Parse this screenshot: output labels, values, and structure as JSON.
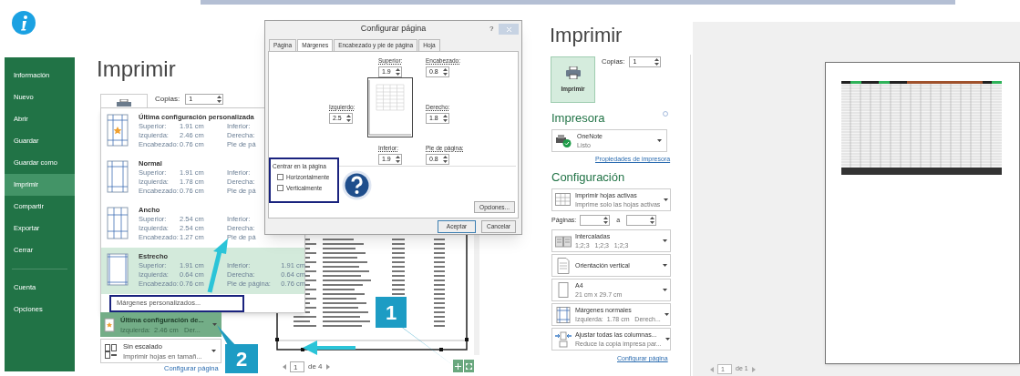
{
  "left_window": {
    "sidebar": {
      "items": [
        {
          "label": "Información",
          "selected": false
        },
        {
          "label": "Nuevo",
          "selected": false
        },
        {
          "label": "Abrir",
          "selected": false
        },
        {
          "label": "Guardar",
          "selected": false
        },
        {
          "label": "Guardar como",
          "selected": false
        },
        {
          "label": "Imprimir",
          "selected": true
        },
        {
          "label": "Compartir",
          "selected": false
        },
        {
          "label": "Exportar",
          "selected": false
        },
        {
          "label": "Cerrar",
          "selected": false
        }
      ],
      "footer_items": [
        {
          "label": "Cuenta",
          "selected": false
        },
        {
          "label": "Opciones",
          "selected": false
        }
      ]
    },
    "title": "Imprimir",
    "copies": {
      "label": "Copias:",
      "value": "1"
    },
    "margins_menu": {
      "options": [
        {
          "kind": "custom",
          "name": "Última configuración personalizada",
          "selected": false,
          "left": [
            [
              "Superior:",
              "1.91 cm"
            ],
            [
              "Izquierda:",
              "2.46 cm"
            ],
            [
              "Encabezado:",
              "0.76 cm"
            ]
          ],
          "right": [
            [
              "Inferior:"
            ],
            [
              "Derecha:"
            ],
            [
              "Pie de pá"
            ]
          ]
        },
        {
          "kind": "normal",
          "name": "Normal",
          "selected": false,
          "left": [
            [
              "Superior:",
              "1.91 cm"
            ],
            [
              "Izquierda:",
              "1.78 cm"
            ],
            [
              "Encabezado:",
              "0.76 cm"
            ]
          ],
          "right": [
            [
              "Inferior:"
            ],
            [
              "Derecha:"
            ],
            [
              "Pie de pá"
            ]
          ]
        },
        {
          "kind": "wide",
          "name": "Ancho",
          "selected": false,
          "left": [
            [
              "Superior:",
              "2.54 cm"
            ],
            [
              "Izquierda:",
              "2.54 cm"
            ],
            [
              "Encabezado:",
              "1.27 cm"
            ]
          ],
          "right": [
            [
              "Inferior:"
            ],
            [
              "Derecha:"
            ],
            [
              "Pie de pá"
            ]
          ]
        },
        {
          "kind": "narrow",
          "name": "Estrecho",
          "selected": true,
          "left": [
            [
              "Superior:",
              "1.91 cm"
            ],
            [
              "Izquierda:",
              "0.64 cm"
            ],
            [
              "Encabezado:",
              "0.76 cm"
            ]
          ],
          "right": [
            [
              "Inferior:",
              "1.91 cm"
            ],
            [
              "Derecha:",
              "0.64 cm"
            ],
            [
              "Pie de página:",
              "0.76 cm"
            ]
          ]
        }
      ],
      "custom_item": "Márgenes personalizados..."
    },
    "settings": [
      {
        "kind": "custom",
        "title": "Última configuración de...",
        "subtitle": "Izquierda:  2.46 cm   Der...",
        "selected": true
      },
      {
        "kind": "scaling",
        "title": "Sin escalado",
        "subtitle": "Imprimir hojas en tamañ...",
        "selected": false
      }
    ],
    "setup_link": "Configurar página",
    "preview_nav": {
      "page": "1",
      "total": "de 4"
    }
  },
  "dialog": {
    "title": "Configurar página",
    "help": "?",
    "tabs": [
      {
        "label": "Página",
        "selected": false
      },
      {
        "label": "Márgenes",
        "selected": true
      },
      {
        "label": "Encabezado y pie de página",
        "selected": false
      },
      {
        "label": "Hoja",
        "selected": false
      }
    ],
    "fields": [
      {
        "label": "Superior:",
        "value": "1.9"
      },
      {
        "label": "Encabezado:",
        "value": "0.8"
      },
      {
        "label": "Izquierdo:",
        "value": "2.5"
      },
      {
        "label": "Derecho:",
        "value": "1.8"
      },
      {
        "label": "Inferior:",
        "value": "1.9"
      },
      {
        "label": "Pie de página:",
        "value": "0.8"
      }
    ],
    "center_group": {
      "title": "Centrar en la página",
      "options": [
        {
          "label": "Horizontalmente",
          "checked": false
        },
        {
          "label": "Verticalmente",
          "checked": false
        }
      ]
    },
    "options_button": "Opciones...",
    "ok_button": "Aceptar",
    "cancel_button": "Cancelar"
  },
  "callouts": [
    "1",
    "2"
  ],
  "right_window": {
    "title": "Imprimir",
    "print_button": "Imprimir",
    "copies": {
      "label": "Copias:",
      "value": "1"
    },
    "printer_heading": "Impresora",
    "printer": {
      "name": "OneNote",
      "status": "Listo"
    },
    "printer_link": "Propiedades de impresora",
    "settings_heading": "Configuración",
    "settings": [
      {
        "kind": "sheets",
        "title": "Imprimir hojas activas",
        "subtitle": "Imprime solo las hojas activas"
      },
      {
        "kind": "pages",
        "label": "Páginas:",
        "separator": "a"
      },
      {
        "kind": "collate",
        "title": "Intercaladas",
        "subtitle": "1;2;3   1;2;3   1;2;3"
      },
      {
        "kind": "orientation",
        "title": "Orientación vertical"
      },
      {
        "kind": "paper",
        "title": "A4",
        "subtitle": "21 cm x 29.7 cm"
      },
      {
        "kind": "margins",
        "title": "Márgenes normales",
        "subtitle": "Izquierda:  1.78 cm   Derech..."
      },
      {
        "kind": "fit",
        "title": "Ajustar todas las columnas...",
        "subtitle": "Reduce la copia impresa par..."
      }
    ],
    "setup_link": "Configurar página",
    "preview_nav": {
      "page": "1",
      "total": "de 1"
    }
  }
}
